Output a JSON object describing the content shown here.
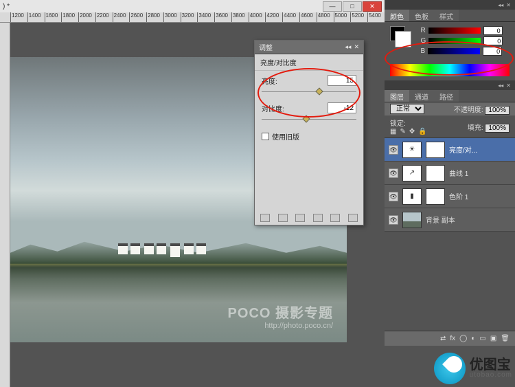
{
  "title_suffix": ") *",
  "win": {
    "min": "—",
    "max": "□",
    "close": "✕"
  },
  "ruler_marks": [
    "1200",
    "1400",
    "1600",
    "1800",
    "2000",
    "2200",
    "2400",
    "2600",
    "2800",
    "3000",
    "3200",
    "3400",
    "3600",
    "3800",
    "4000",
    "4200",
    "4400",
    "4600",
    "4800",
    "5000",
    "5200",
    "5400"
  ],
  "adjust": {
    "panel_tab": "调整",
    "title": "亮度/对比度",
    "brightness_label": "亮度:",
    "brightness_value": "15",
    "contrast_label": "对比度:",
    "contrast_value": "-12",
    "legacy": "使用旧版"
  },
  "color_panel": {
    "tabs": [
      "颜色",
      "色板",
      "样式"
    ],
    "r_label": "R",
    "g_label": "G",
    "b_label": "B",
    "r": "0",
    "g": "0",
    "b": "0"
  },
  "layers": {
    "tabs": [
      "图层",
      "通道",
      "路径"
    ],
    "blend_mode": "正常",
    "opacity_label": "不透明度:",
    "opacity": "100%",
    "lock_label": "锁定:",
    "fill_label": "填充:",
    "fill": "100%",
    "items": [
      {
        "name": "亮度/对...",
        "icon": "☀"
      },
      {
        "name": "曲线 1",
        "icon": "↗"
      },
      {
        "name": "色阶 1",
        "icon": "▮"
      },
      {
        "name": "背景 副本",
        "icon": "img"
      }
    ]
  },
  "watermark": {
    "line1": "POCO 摄影专题",
    "line2": "http://photo.poco.cn/"
  },
  "logo": {
    "text": "优图宝",
    "sub": "utobao.com"
  }
}
